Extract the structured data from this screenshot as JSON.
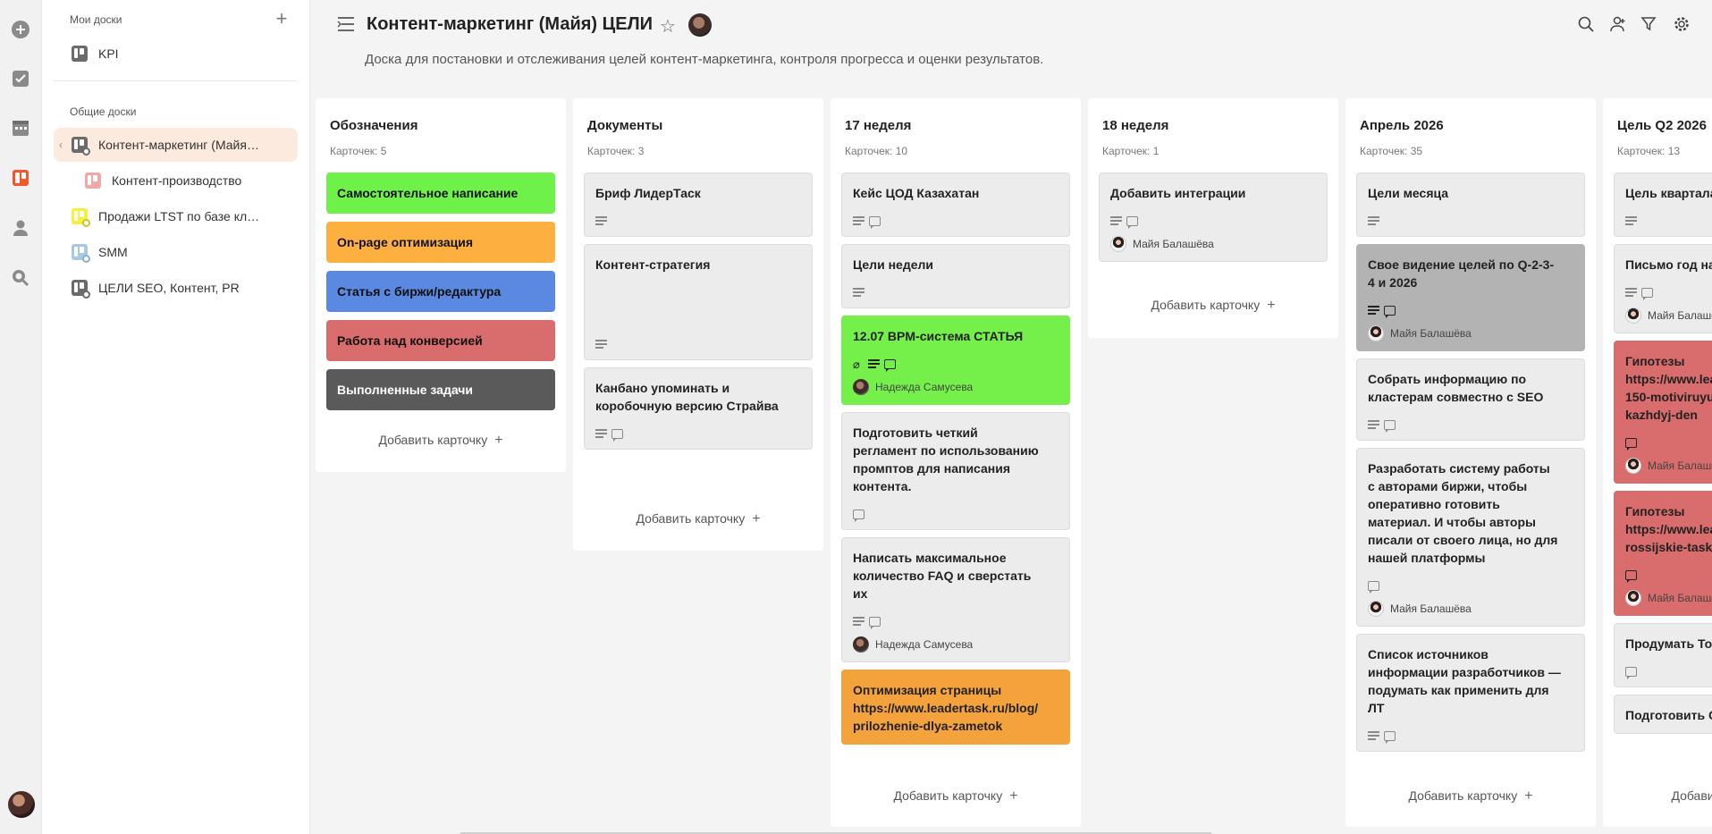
{
  "rail": {
    "items": [
      "add-icon",
      "tasks-icon",
      "calendar-icon",
      "boards-icon",
      "contacts-icon",
      "search-docs-icon"
    ]
  },
  "sidebar": {
    "my_boards_label": "Мои доски",
    "my_boards": [
      {
        "label": "KPI",
        "color": "#6b6b6b"
      }
    ],
    "shared_boards_label": "Общие доски",
    "shared_boards": [
      {
        "label": "Контент-маркетинг (Майя…",
        "color": "#6b6b6b",
        "active": true
      },
      {
        "label": "Контент-производство",
        "color": "#f2a8a8",
        "indent": true
      },
      {
        "label": "Продажи LTST по базе кл…",
        "color": "#f4f03c"
      },
      {
        "label": "SMM",
        "color": "#a9c8e6"
      },
      {
        "label": "ЦЕЛИ SEO, Контент, PR",
        "color": "#6b6b6b"
      }
    ]
  },
  "header": {
    "title": "Контент-маркетинг (Майя) ЦЕЛИ",
    "description": "Доска для постановки и отслеживания целей контент-маркетинга, контроля прогресса и оценки результатов.",
    "tools": [
      "search-icon",
      "members-icon",
      "filter-icon",
      "settings-icon"
    ]
  },
  "add_card_label": "Добавить карточку",
  "columns": [
    {
      "title": "Обозначения",
      "count": "Карточек: 5",
      "legend": [
        {
          "label": "Самостоятельное написание",
          "color": "#6ef24a",
          "text_color": "#111"
        },
        {
          "label": "On-page оптимизация",
          "color": "#fdb040",
          "text_color": "#111"
        },
        {
          "label": "Статья с биржи/редактура",
          "color": "#5b88e0",
          "text_color": "#111"
        },
        {
          "label": "Работа над конверсией",
          "color": "#d96c6c",
          "text_color": "#111"
        },
        {
          "label": "Выполненные задачи",
          "color": "#5a5a5a",
          "text_color": "#ffffff"
        }
      ]
    },
    {
      "title": "Документы",
      "count": "Карточек: 3",
      "cards": [
        {
          "text": "Бриф ЛидерТаск",
          "icons": [
            "lines"
          ]
        },
        {
          "text": "Контент-стратегия",
          "icons": [
            "lines"
          ],
          "tall": true
        },
        {
          "text": "Канбано упоминать и\nкоробочную версию Страйва",
          "icons": [
            "lines",
            "comment"
          ]
        }
      ]
    },
    {
      "title": "17 неделя",
      "count": "Карточек: 10",
      "cards": [
        {
          "text": "Кейс ЦОД Казахатан",
          "icons": [
            "lines",
            "comment"
          ]
        },
        {
          "text": "Цели недели",
          "icons": [
            "lines"
          ]
        },
        {
          "text": "12.07 BPM-система СТАТЬЯ",
          "icons": [
            "clip",
            "lines",
            "comment"
          ],
          "user": "Надежда Самусева",
          "avatar": "nadya",
          "color": "#75f04a"
        },
        {
          "text": "Подготовить четкий\nрегламент по использованию\nпромптов для написания\nконтента.",
          "icons": [
            "comment"
          ]
        },
        {
          "text": "Написать максимальное\nколичество FAQ и сверстать\nих",
          "icons": [
            "lines",
            "comment"
          ],
          "user": "Надежда Самусева",
          "avatar": "nadya"
        },
        {
          "text": "Оптимизация страницы\nhttps://www.leadertask.ru/blog/\nprilozhenie-dlya-zametok",
          "icons": [],
          "color": "#f3a23c"
        }
      ]
    },
    {
      "title": "18 неделя",
      "count": "Карточек: 1",
      "cards": [
        {
          "text": "Добавить интеграции",
          "icons": [
            "lines",
            "comment"
          ],
          "user": "Майя Балашёва",
          "avatar": "maya"
        }
      ]
    },
    {
      "title": "Апрель 2026",
      "count": "Карточек: 35",
      "cards": [
        {
          "text": "Цели месяца",
          "icons": [
            "lines"
          ]
        },
        {
          "text": "Свое видение целей по Q-2-3-\n4 и 2026",
          "icons": [
            "lines",
            "comment"
          ],
          "user": "Майя Балашёва",
          "avatar": "maya",
          "color": "#b3b3b3",
          "dark_icons": true
        },
        {
          "text": "Собрать информацию по\nкластерам совместно с SEO",
          "icons": [
            "lines",
            "comment"
          ]
        },
        {
          "text": "Разработать систему работы\nс авторами биржи, чтобы\nоперативно готовить\nматериал. И чтобы авторы\nписали от своего лица, но для\nнашей платформы",
          "icons": [
            "comment"
          ],
          "user": "Майя Балашёва",
          "avatar": "maya"
        },
        {
          "text": "Список источников\nинформации разработчиков —\nподумать как применить для\nЛТ",
          "icons": [
            "lines",
            "comment"
          ]
        }
      ]
    },
    {
      "title": "Цель Q2 2026",
      "count": "Карточек: 13",
      "cards": [
        {
          "text": "Цель квартала",
          "icons": [
            "lines"
          ]
        },
        {
          "text": "Письмо год на",
          "icons": [
            "lines",
            "comment"
          ],
          "user": "Майя Балашёва",
          "avatar": "maya"
        },
        {
          "text": "Гипотезы\nhttps://www.lea\n150-motiviruyu\nkazhdyj-den",
          "icons": [
            "comment"
          ],
          "user": "Майя Балашёва",
          "avatar": "maya",
          "color": "#d96c6c"
        },
        {
          "text": "Гипотезы\nhttps://www.lea\nrossijskie-task",
          "icons": [
            "comment"
          ],
          "user": "Майя Балашёва",
          "avatar": "maya",
          "color": "#d96c6c"
        },
        {
          "text": "Продумать ТоV",
          "icons": [
            "comment"
          ]
        },
        {
          "text": "Подготовить С",
          "icons": []
        }
      ]
    }
  ]
}
